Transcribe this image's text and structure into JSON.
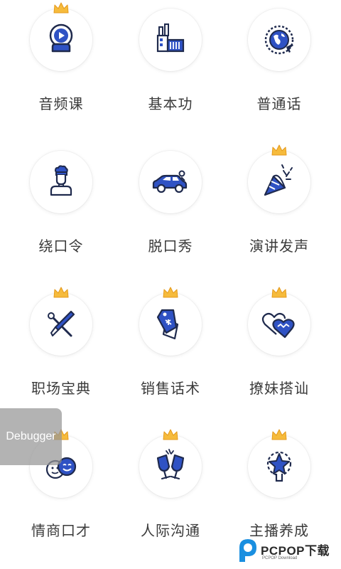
{
  "colors": {
    "navy": "#1f2a4d",
    "blue": "#2f52c4",
    "crown": "#f6bb3c",
    "label": "#3a3a3a"
  },
  "courses": [
    {
      "label": "音频课",
      "icon": "audio-course-icon",
      "premium": true
    },
    {
      "label": "基本功",
      "icon": "factory-icon",
      "premium": false
    },
    {
      "label": "普通话",
      "icon": "globe-airplane-icon",
      "premium": false
    },
    {
      "label": "绕口令",
      "icon": "chef-person-icon",
      "premium": false
    },
    {
      "label": "脱口秀",
      "icon": "car-icon",
      "premium": false
    },
    {
      "label": "演讲发声",
      "icon": "party-popper-icon",
      "premium": true
    },
    {
      "label": "职场宝典",
      "icon": "crossed-tools-icon",
      "premium": true
    },
    {
      "label": "销售话术",
      "icon": "price-tag-icon",
      "premium": true
    },
    {
      "label": "撩妹搭讪",
      "icon": "two-hearts-icon",
      "premium": true
    },
    {
      "label": "情商口才",
      "icon": "faces-icon",
      "premium": true
    },
    {
      "label": "人际沟通",
      "icon": "cheers-glasses-icon",
      "premium": true
    },
    {
      "label": "主播养成",
      "icon": "star-trophy-icon",
      "premium": true
    }
  ],
  "debugger": {
    "label": "Debugger"
  },
  "watermark": {
    "brand": "PCPOP",
    "brand_cn": "下载",
    "sub": "PCPOP Download"
  }
}
